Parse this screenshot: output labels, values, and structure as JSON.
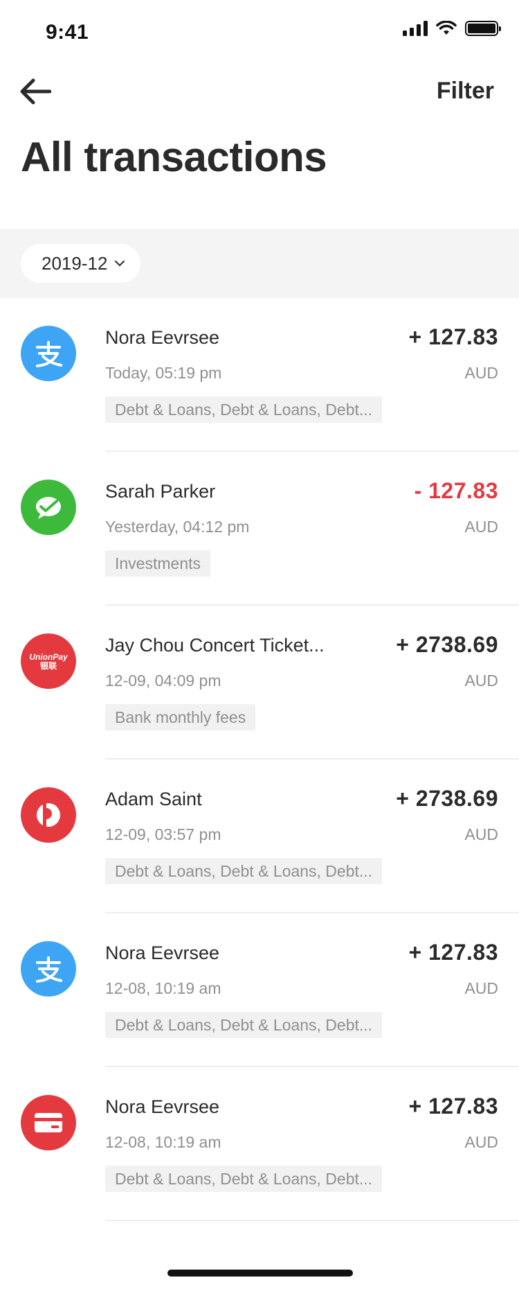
{
  "status": {
    "time": "9:41"
  },
  "nav": {
    "filter_label": "Filter"
  },
  "title": "All transactions",
  "period": {
    "selected": "2019-12"
  },
  "transactions": [
    {
      "icon": "alipay-icon",
      "icon_color": "#3ea5f5",
      "name": "Nora Eevrsee",
      "time": "Today, 05:19 pm",
      "amount": "+ 127.83",
      "currency": "AUD",
      "tags": "Debt & Loans, Debt & Loans, Debt...",
      "negative": false
    },
    {
      "icon": "wechat-pay-icon",
      "icon_color": "#3dba3b",
      "name": "Sarah Parker",
      "time": "Yesterday, 04:12 pm",
      "amount": "- 127.83",
      "currency": "AUD",
      "tags": "Investments",
      "negative": true
    },
    {
      "icon": "unionpay-icon",
      "icon_color": "#e43a3f",
      "icon_text_1": "UnionPay",
      "icon_text_2": "银联",
      "name": "Jay Chou Concert Ticket...",
      "time": "12-09, 04:09 pm",
      "amount": "+ 2738.69",
      "currency": "AUD",
      "tags": "Bank monthly fees",
      "negative": false
    },
    {
      "icon": "auspost-icon",
      "icon_color": "#e43a3f",
      "name": "Adam Saint",
      "time": "12-09, 03:57 pm",
      "amount": "+ 2738.69",
      "currency": "AUD",
      "tags": "Debt & Loans, Debt & Loans, Debt...",
      "negative": false
    },
    {
      "icon": "alipay-icon",
      "icon_color": "#3ea5f5",
      "name": "Nora Eevrsee",
      "time": "12-08, 10:19 am",
      "amount": "+ 127.83",
      "currency": "AUD",
      "tags": "Debt & Loans, Debt & Loans, Debt...",
      "negative": false
    },
    {
      "icon": "card-icon",
      "icon_color": "#e43a3f",
      "name": "Nora Eevrsee",
      "time": "12-08, 10:19 am",
      "amount": "+ 127.83",
      "currency": "AUD",
      "tags": "Debt & Loans, Debt & Loans, Debt...",
      "negative": false
    }
  ],
  "colors": {
    "negative": "#e23a43",
    "text": "#2a2a2a",
    "muted": "#8f8f8f"
  }
}
